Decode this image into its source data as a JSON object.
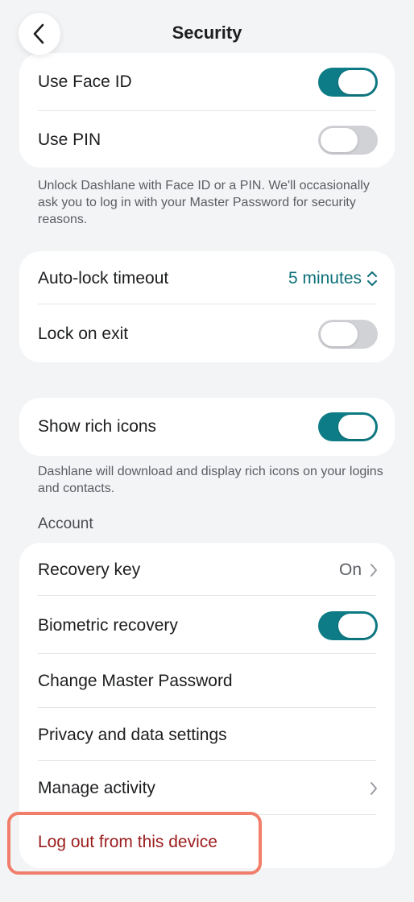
{
  "header": {
    "title": "Security"
  },
  "unlock": {
    "face_id_label": "Use Face ID",
    "face_id_on": true,
    "pin_label": "Use PIN",
    "pin_on": false,
    "footnote": "Unlock Dashlane with Face ID or a PIN. We'll occasionally ask you to log in with your Master Password for security reasons."
  },
  "lock": {
    "autolock_label": "Auto-lock timeout",
    "autolock_value": "5 minutes",
    "lock_on_exit_label": "Lock on exit",
    "lock_on_exit_on": false
  },
  "icons": {
    "rich_icons_label": "Show rich icons",
    "rich_icons_on": true,
    "footnote": "Dashlane will download and display rich icons on your logins and contacts."
  },
  "account": {
    "section_title": "Account",
    "recovery_key_label": "Recovery key",
    "recovery_key_value": "On",
    "biometric_label": "Biometric recovery",
    "biometric_on": true,
    "change_password_label": "Change Master Password",
    "privacy_label": "Privacy and data settings",
    "manage_activity_label": "Manage activity",
    "logout_label": "Log out from this device"
  },
  "colors": {
    "accent": "#0e7c86",
    "destructive": "#9b1c1c",
    "highlight": "#f07e6a"
  }
}
